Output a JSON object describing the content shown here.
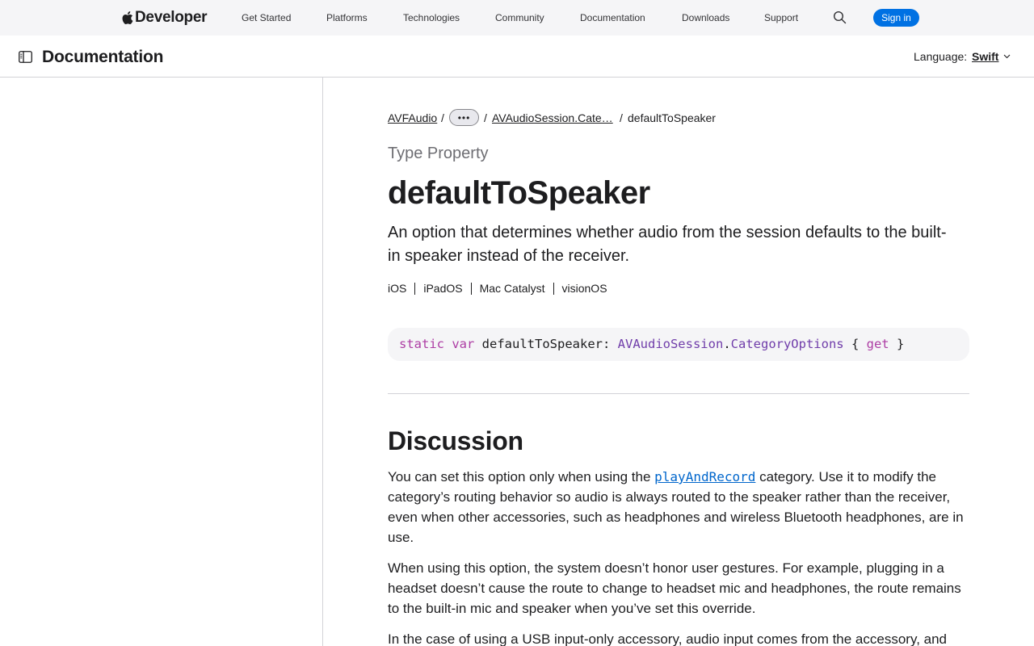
{
  "global_nav": {
    "brand": "Developer",
    "links": [
      "Get Started",
      "Platforms",
      "Technologies",
      "Community",
      "Documentation",
      "Downloads",
      "Support"
    ],
    "search_icon": "search-icon",
    "sign_in": "Sign in",
    "accent_color": "#0071e3"
  },
  "doc_header": {
    "title": "Documentation",
    "sidebar_icon": "sidebar-toggle-icon",
    "language_label": "Language:",
    "language_value": "Swift"
  },
  "breadcrumb": {
    "items": [
      "AVFAudio",
      "AVAudioSession.Cate…",
      "defaultToSpeaker"
    ],
    "more_label": "•••",
    "separator": "/"
  },
  "page": {
    "eyebrow": "Type Property",
    "title": "defaultToSpeaker",
    "abstract": "An option that determines whether audio from the session defaults to the built-in speaker instead of the receiver.",
    "platforms": [
      "iOS",
      "iPadOS",
      "Mac Catalyst",
      "visionOS"
    ]
  },
  "declaration": {
    "tokens": [
      {
        "text": "static",
        "kind": "keyword"
      },
      {
        "text": " ",
        "kind": "plain"
      },
      {
        "text": "var",
        "kind": "keyword"
      },
      {
        "text": " defaultToSpeaker: ",
        "kind": "plain"
      },
      {
        "text": "AVAudioSession",
        "kind": "type"
      },
      {
        "text": ".",
        "kind": "plain"
      },
      {
        "text": "CategoryOptions",
        "kind": "type"
      },
      {
        "text": " { ",
        "kind": "plain"
      },
      {
        "text": "get",
        "kind": "keyword"
      },
      {
        "text": " }",
        "kind": "plain"
      }
    ]
  },
  "discussion": {
    "title": "Discussion",
    "p1_before": "You can set this option only when using the ",
    "p1_link": "playAndRecord",
    "p1_after": " category. Use it to modify the category’s routing behavior so audio is always routed to the speaker rather than the receiver, even when other accessories, such as headphones and wireless Bluetooth headphones, are in use.",
    "p2": "When using this option, the system doesn’t honor user gestures. For example, plugging in a headset doesn’t cause the route to change to headset mic and headphones, the route remains to the built-in mic and speaker when you’ve set this override.",
    "p3": "In the case of using a USB input-only accessory, audio input comes from the accessory, and"
  }
}
